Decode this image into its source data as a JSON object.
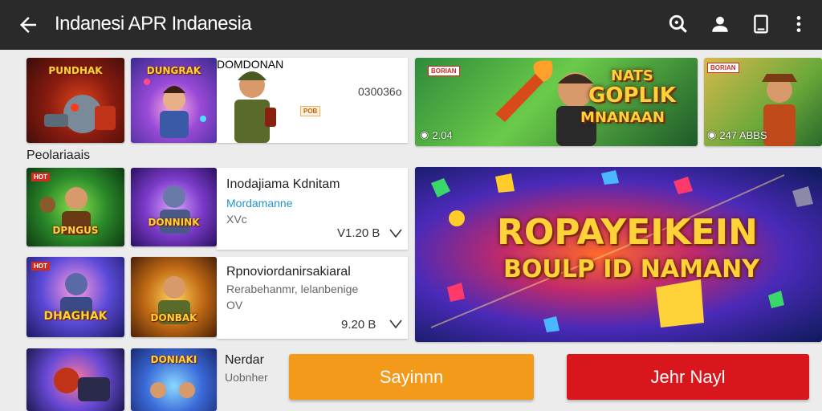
{
  "appbar": {
    "title": "Indanesi APR Indanesia",
    "icons": [
      "back-arrow-icon",
      "search-icon",
      "account-icon",
      "tablet-icon",
      "more-vert-icon"
    ],
    "background": "#2a2a2a"
  },
  "top_row": {
    "thumbs": [
      {
        "caption": "PUNDHAK",
        "tag": ""
      },
      {
        "caption": "DUNGRAK",
        "tag": ""
      },
      {
        "caption": "DOMDONAN",
        "tag": ""
      }
    ],
    "detail": {
      "value": "030036o",
      "badge": "POB"
    },
    "banner_1": {
      "text_line1": "NATS",
      "text_line2": "GOPLIK",
      "text_line3": "MNANAAN",
      "tag": "BORIAN",
      "stat": "2.04"
    },
    "banner_2": {
      "tag": "BORIAN",
      "stat": "247 ABBS"
    }
  },
  "section": {
    "label": "Peolariaais"
  },
  "list_items": [
    {
      "title": "Inodajiama Kdnitam",
      "subtitle": "Mordamanne",
      "meta": "XVc",
      "price": "V1.20 B",
      "thumb_captions": [
        "DPNGUS",
        "DONNINK"
      ]
    },
    {
      "title": "Rpnoviordanirsakiaral",
      "subtitle": "Rerabehanmr, lelanbenige",
      "meta": "OV",
      "price": "9.20 B",
      "thumb_captions": [
        "DHAGHAK",
        "DONBAK"
      ]
    },
    {
      "title": "Nerdar",
      "subtitle": "Uobnher",
      "thumb_captions": [
        "",
        "DONIAKI"
      ]
    }
  ],
  "big_banner": {
    "line1": "ROPAYEIKEIN",
    "line2": "BOULP ID NAMANY"
  },
  "buttons": {
    "primary_label": "Sayinnn",
    "secondary_label": "Jehr Nayl",
    "primary_color": "#f39a1a",
    "secondary_color": "#d8161c"
  }
}
